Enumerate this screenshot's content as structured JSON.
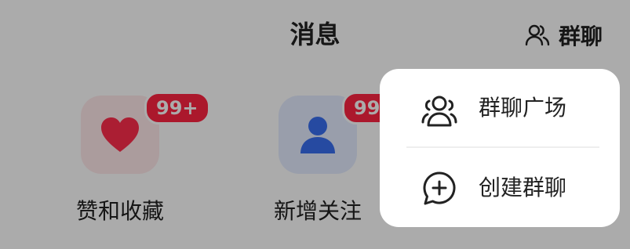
{
  "header": {
    "title": "消息",
    "group_chat_label": "群聊"
  },
  "tiles": [
    {
      "label": "赞和收藏",
      "badge": "99+",
      "icon": "heart-icon"
    },
    {
      "label": "新增关注",
      "badge": "99+",
      "icon": "person-icon"
    }
  ],
  "popup_menu": {
    "items": [
      {
        "label": "群聊广场",
        "icon": "group-icon"
      },
      {
        "label": "创建群聊",
        "icon": "chat-plus-icon"
      }
    ]
  },
  "colors": {
    "badge": "#ff2442",
    "heart": "#ff2e4d",
    "person": "#3a6ff0",
    "overlay": "rgba(0,0,0,0.33)"
  }
}
